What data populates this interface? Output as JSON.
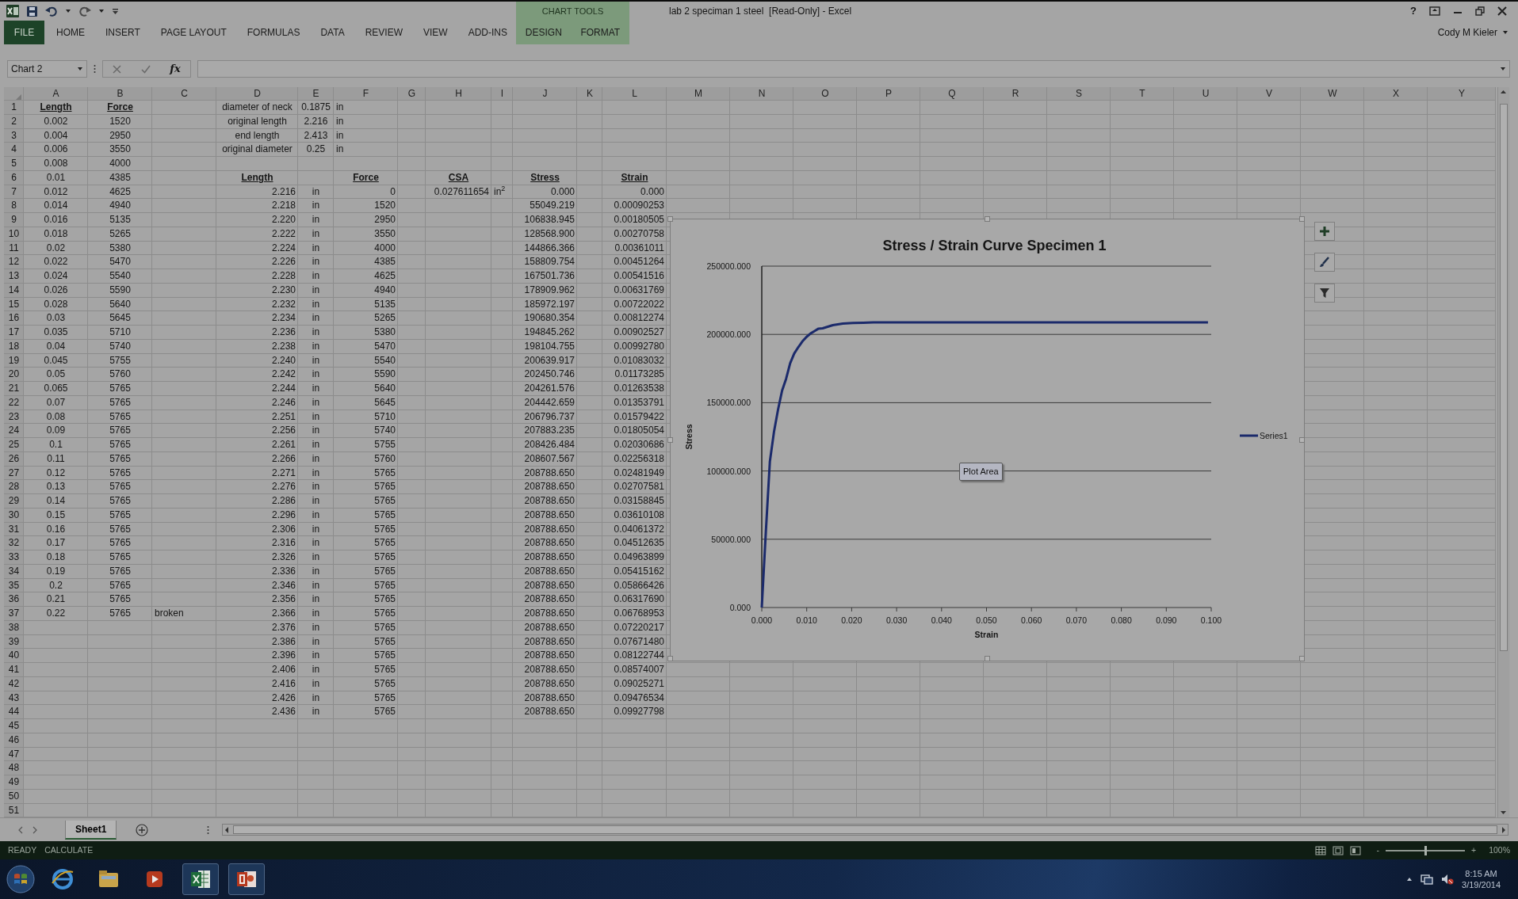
{
  "title_bar": {
    "title": "lab 2 speciman 1 steel  [Read-Only] - Excel",
    "help": "?"
  },
  "ribbon": {
    "tabs": [
      {
        "label": "FILE",
        "kind": "file",
        "selected": false
      },
      {
        "label": "HOME",
        "kind": "tab",
        "selected": false
      },
      {
        "label": "INSERT",
        "kind": "tab",
        "selected": false
      },
      {
        "label": "PAGE LAYOUT",
        "kind": "tab",
        "selected": false
      },
      {
        "label": "FORMULAS",
        "kind": "tab",
        "selected": false
      },
      {
        "label": "DATA",
        "kind": "tab",
        "selected": false
      },
      {
        "label": "REVIEW",
        "kind": "tab",
        "selected": false
      },
      {
        "label": "VIEW",
        "kind": "tab",
        "selected": false
      },
      {
        "label": "ADD-INS",
        "kind": "tab",
        "selected": false
      }
    ],
    "context": {
      "label": "CHART TOOLS",
      "tabs": [
        {
          "label": "DESIGN",
          "selected": false
        },
        {
          "label": "FORMAT",
          "selected": false
        }
      ]
    },
    "user": "Cody M Kieler"
  },
  "formula_bar": {
    "name_box": "Chart 2",
    "function_label": "fx"
  },
  "sheet": {
    "columns": [
      "A",
      "B",
      "C",
      "D",
      "E",
      "F",
      "G",
      "H",
      "I",
      "J",
      "K",
      "L",
      "M",
      "N",
      "O",
      "P",
      "Q",
      "R",
      "S",
      "T",
      "U",
      "V",
      "W",
      "X",
      "Y"
    ],
    "rows": [
      {
        "number": "1",
        "cells": {
          "A": {
            "text": "Length",
            "kind": "heading"
          },
          "B": {
            "text": "Force",
            "kind": "heading"
          },
          "D": {
            "text": "diameter of neck",
            "kind": "center"
          },
          "E": {
            "text": "0.1875",
            "kind": "center"
          },
          "F": {
            "text": "in",
            "kind": "label"
          }
        }
      },
      {
        "number": "2",
        "cells": {
          "A": {
            "text": "0.002",
            "kind": "center"
          },
          "B": {
            "text": "1520",
            "kind": "center"
          },
          "D": {
            "text": "original length",
            "kind": "center"
          },
          "E": {
            "text": "2.216",
            "kind": "center"
          },
          "F": {
            "text": "in",
            "kind": "label"
          }
        }
      },
      {
        "number": "3",
        "cells": {
          "A": {
            "text": "0.004",
            "kind": "center"
          },
          "B": {
            "text": "2950",
            "kind": "center"
          },
          "D": {
            "text": "end length",
            "kind": "center"
          },
          "E": {
            "text": "2.413",
            "kind": "center"
          },
          "F": {
            "text": "in",
            "kind": "label"
          }
        }
      },
      {
        "number": "4",
        "cells": {
          "A": {
            "text": "0.006",
            "kind": "center"
          },
          "B": {
            "text": "3550",
            "kind": "center"
          },
          "D": {
            "text": "original diameter",
            "kind": "center"
          },
          "E": {
            "text": "0.25",
            "kind": "center"
          },
          "F": {
            "text": "in",
            "kind": "label"
          }
        }
      },
      {
        "number": "5",
        "cells": {
          "A": {
            "text": "0.008",
            "kind": "center"
          },
          "B": {
            "text": "4000",
            "kind": "center"
          }
        }
      },
      {
        "number": "6",
        "cells": {
          "A": {
            "text": "0.01",
            "kind": "center"
          },
          "B": {
            "text": "4385",
            "kind": "center"
          },
          "D": {
            "text": "Length",
            "kind": "heading"
          },
          "F": {
            "text": "Force",
            "kind": "heading"
          },
          "H": {
            "text": "CSA",
            "kind": "heading"
          },
          "J": {
            "text": "Stress",
            "kind": "heading"
          },
          "L": {
            "text": "Strain",
            "kind": "heading"
          }
        }
      },
      {
        "number": "7",
        "cells": {
          "A": {
            "text": "0.012",
            "kind": "center"
          },
          "B": {
            "text": "4625",
            "kind": "center"
          },
          "D": {
            "text": "2.216",
            "kind": "number"
          },
          "E": {
            "text": "in",
            "kind": "center"
          },
          "F": {
            "text": "0",
            "kind": "number"
          },
          "H": {
            "text": "0.027611654",
            "kind": "number"
          },
          "I": {
            "text": "in$^{2}$",
            "kind": "label"
          },
          "J": {
            "text": "0.000",
            "kind": "number"
          },
          "L": {
            "text": "0.000",
            "kind": "number"
          }
        }
      },
      {
        "number": "8",
        "cells": {
          "A": {
            "text": "0.014",
            "kind": "center"
          },
          "B": {
            "text": "4940",
            "kind": "center"
          },
          "D": {
            "text": "2.218",
            "kind": "number"
          },
          "E": {
            "text": "in",
            "kind": "center"
          },
          "F": {
            "text": "1520",
            "kind": "number"
          },
          "J": {
            "text": "55049.219",
            "kind": "number"
          },
          "L": {
            "text": "0.00090253",
            "kind": "number"
          }
        }
      },
      {
        "number": "9",
        "cells": {
          "A": {
            "text": "0.016",
            "kind": "center"
          },
          "B": {
            "text": "5135",
            "kind": "center"
          },
          "D": {
            "text": "2.220",
            "kind": "number"
          },
          "E": {
            "text": "in",
            "kind": "center"
          },
          "F": {
            "text": "2950",
            "kind": "number"
          },
          "J": {
            "text": "106838.945",
            "kind": "number"
          },
          "L": {
            "text": "0.00180505",
            "kind": "number"
          }
        }
      },
      {
        "number": "10",
        "cells": {
          "A": {
            "text": "0.018",
            "kind": "center"
          },
          "B": {
            "text": "5265",
            "kind": "center"
          },
          "D": {
            "text": "2.222",
            "kind": "number"
          },
          "E": {
            "text": "in",
            "kind": "center"
          },
          "F": {
            "text": "3550",
            "kind": "number"
          },
          "J": {
            "text": "128568.900",
            "kind": "number"
          },
          "L": {
            "text": "0.00270758",
            "kind": "number"
          }
        }
      },
      {
        "number": "11",
        "cells": {
          "A": {
            "text": "0.02",
            "kind": "center"
          },
          "B": {
            "text": "5380",
            "kind": "center"
          },
          "D": {
            "text": "2.224",
            "kind": "number"
          },
          "E": {
            "text": "in",
            "kind": "center"
          },
          "F": {
            "text": "4000",
            "kind": "number"
          },
          "J": {
            "text": "144866.366",
            "kind": "number"
          },
          "L": {
            "text": "0.00361011",
            "kind": "number"
          }
        }
      },
      {
        "number": "12",
        "cells": {
          "A": {
            "text": "0.022",
            "kind": "center"
          },
          "B": {
            "text": "5470",
            "kind": "center"
          },
          "D": {
            "text": "2.226",
            "kind": "number"
          },
          "E": {
            "text": "in",
            "kind": "center"
          },
          "F": {
            "text": "4385",
            "kind": "number"
          },
          "J": {
            "text": "158809.754",
            "kind": "number"
          },
          "L": {
            "text": "0.00451264",
            "kind": "number"
          }
        }
      },
      {
        "number": "13",
        "cells": {
          "A": {
            "text": "0.024",
            "kind": "center"
          },
          "B": {
            "text": "5540",
            "kind": "center"
          },
          "D": {
            "text": "2.228",
            "kind": "number"
          },
          "E": {
            "text": "in",
            "kind": "center"
          },
          "F": {
            "text": "4625",
            "kind": "number"
          },
          "J": {
            "text": "167501.736",
            "kind": "number"
          },
          "L": {
            "text": "0.00541516",
            "kind": "number"
          }
        }
      },
      {
        "number": "14",
        "cells": {
          "A": {
            "text": "0.026",
            "kind": "center"
          },
          "B": {
            "text": "5590",
            "kind": "center"
          },
          "D": {
            "text": "2.230",
            "kind": "number"
          },
          "E": {
            "text": "in",
            "kind": "center"
          },
          "F": {
            "text": "4940",
            "kind": "number"
          },
          "J": {
            "text": "178909.962",
            "kind": "number"
          },
          "L": {
            "text": "0.00631769",
            "kind": "number"
          }
        }
      },
      {
        "number": "15",
        "cells": {
          "A": {
            "text": "0.028",
            "kind": "center"
          },
          "B": {
            "text": "5640",
            "kind": "center"
          },
          "D": {
            "text": "2.232",
            "kind": "number"
          },
          "E": {
            "text": "in",
            "kind": "center"
          },
          "F": {
            "text": "5135",
            "kind": "number"
          },
          "J": {
            "text": "185972.197",
            "kind": "number"
          },
          "L": {
            "text": "0.00722022",
            "kind": "number"
          }
        }
      },
      {
        "number": "16",
        "cells": {
          "A": {
            "text": "0.03",
            "kind": "center"
          },
          "B": {
            "text": "5645",
            "kind": "center"
          },
          "D": {
            "text": "2.234",
            "kind": "number"
          },
          "E": {
            "text": "in",
            "kind": "center"
          },
          "F": {
            "text": "5265",
            "kind": "number"
          },
          "J": {
            "text": "190680.354",
            "kind": "number"
          },
          "L": {
            "text": "0.00812274",
            "kind": "number"
          }
        }
      },
      {
        "number": "17",
        "cells": {
          "A": {
            "text": "0.035",
            "kind": "center"
          },
          "B": {
            "text": "5710",
            "kind": "center"
          },
          "D": {
            "text": "2.236",
            "kind": "number"
          },
          "E": {
            "text": "in",
            "kind": "center"
          },
          "F": {
            "text": "5380",
            "kind": "number"
          },
          "J": {
            "text": "194845.262",
            "kind": "number"
          },
          "L": {
            "text": "0.00902527",
            "kind": "number"
          }
        }
      },
      {
        "number": "18",
        "cells": {
          "A": {
            "text": "0.04",
            "kind": "center"
          },
          "B": {
            "text": "5740",
            "kind": "center"
          },
          "D": {
            "text": "2.238",
            "kind": "number"
          },
          "E": {
            "text": "in",
            "kind": "center"
          },
          "F": {
            "text": "5470",
            "kind": "number"
          },
          "J": {
            "text": "198104.755",
            "kind": "number"
          },
          "L": {
            "text": "0.00992780",
            "kind": "number"
          }
        }
      },
      {
        "number": "19",
        "cells": {
          "A": {
            "text": "0.045",
            "kind": "center"
          },
          "B": {
            "text": "5755",
            "kind": "center"
          },
          "D": {
            "text": "2.240",
            "kind": "number"
          },
          "E": {
            "text": "in",
            "kind": "center"
          },
          "F": {
            "text": "5540",
            "kind": "number"
          },
          "J": {
            "text": "200639.917",
            "kind": "number"
          },
          "L": {
            "text": "0.01083032",
            "kind": "number"
          }
        }
      },
      {
        "number": "20",
        "cells": {
          "A": {
            "text": "0.05",
            "kind": "center"
          },
          "B": {
            "text": "5760",
            "kind": "center"
          },
          "D": {
            "text": "2.242",
            "kind": "number"
          },
          "E": {
            "text": "in",
            "kind": "center"
          },
          "F": {
            "text": "5590",
            "kind": "number"
          },
          "J": {
            "text": "202450.746",
            "kind": "number"
          },
          "L": {
            "text": "0.01173285",
            "kind": "number"
          }
        }
      },
      {
        "number": "21",
        "cells": {
          "A": {
            "text": "0.065",
            "kind": "center"
          },
          "B": {
            "text": "5765",
            "kind": "center"
          },
          "D": {
            "text": "2.244",
            "kind": "number"
          },
          "E": {
            "text": "in",
            "kind": "center"
          },
          "F": {
            "text": "5640",
            "kind": "number"
          },
          "J": {
            "text": "204261.576",
            "kind": "number"
          },
          "L": {
            "text": "0.01263538",
            "kind": "number"
          }
        }
      },
      {
        "number": "22",
        "cells": {
          "A": {
            "text": "0.07",
            "kind": "center"
          },
          "B": {
            "text": "5765",
            "kind": "center"
          },
          "D": {
            "text": "2.246",
            "kind": "number"
          },
          "E": {
            "text": "in",
            "kind": "center"
          },
          "F": {
            "text": "5645",
            "kind": "number"
          },
          "J": {
            "text": "204442.659",
            "kind": "number"
          },
          "L": {
            "text": "0.01353791",
            "kind": "number"
          }
        }
      },
      {
        "number": "23",
        "cells": {
          "A": {
            "text": "0.08",
            "kind": "center"
          },
          "B": {
            "text": "5765",
            "kind": "center"
          },
          "D": {
            "text": "2.251",
            "kind": "number"
          },
          "E": {
            "text": "in",
            "kind": "center"
          },
          "F": {
            "text": "5710",
            "kind": "number"
          },
          "J": {
            "text": "206796.737",
            "kind": "number"
          },
          "L": {
            "text": "0.01579422",
            "kind": "number"
          }
        }
      },
      {
        "number": "24",
        "cells": {
          "A": {
            "text": "0.09",
            "kind": "center"
          },
          "B": {
            "text": "5765",
            "kind": "center"
          },
          "D": {
            "text": "2.256",
            "kind": "number"
          },
          "E": {
            "text": "in",
            "kind": "center"
          },
          "F": {
            "text": "5740",
            "kind": "number"
          },
          "J": {
            "text": "207883.235",
            "kind": "number"
          },
          "L": {
            "text": "0.01805054",
            "kind": "number"
          }
        }
      },
      {
        "number": "25",
        "cells": {
          "A": {
            "text": "0.1",
            "kind": "center"
          },
          "B": {
            "text": "5765",
            "kind": "center"
          },
          "D": {
            "text": "2.261",
            "kind": "number"
          },
          "E": {
            "text": "in",
            "kind": "center"
          },
          "F": {
            "text": "5755",
            "kind": "number"
          },
          "J": {
            "text": "208426.484",
            "kind": "number"
          },
          "L": {
            "text": "0.02030686",
            "kind": "number"
          }
        }
      },
      {
        "number": "26",
        "cells": {
          "A": {
            "text": "0.11",
            "kind": "center"
          },
          "B": {
            "text": "5765",
            "kind": "center"
          },
          "D": {
            "text": "2.266",
            "kind": "number"
          },
          "E": {
            "text": "in",
            "kind": "center"
          },
          "F": {
            "text": "5760",
            "kind": "number"
          },
          "J": {
            "text": "208607.567",
            "kind": "number"
          },
          "L": {
            "text": "0.02256318",
            "kind": "number"
          }
        }
      },
      {
        "number": "27",
        "cells": {
          "A": {
            "text": "0.12",
            "kind": "center"
          },
          "B": {
            "text": "5765",
            "kind": "center"
          },
          "D": {
            "text": "2.271",
            "kind": "number"
          },
          "E": {
            "text": "in",
            "kind": "center"
          },
          "F": {
            "text": "5765",
            "kind": "number"
          },
          "J": {
            "text": "208788.650",
            "kind": "number"
          },
          "L": {
            "text": "0.02481949",
            "kind": "number"
          }
        }
      },
      {
        "number": "28",
        "cells": {
          "A": {
            "text": "0.13",
            "kind": "center"
          },
          "B": {
            "text": "5765",
            "kind": "center"
          },
          "D": {
            "text": "2.276",
            "kind": "number"
          },
          "E": {
            "text": "in",
            "kind": "center"
          },
          "F": {
            "text": "5765",
            "kind": "number"
          },
          "J": {
            "text": "208788.650",
            "kind": "number"
          },
          "L": {
            "text": "0.02707581",
            "kind": "number"
          }
        }
      },
      {
        "number": "29",
        "cells": {
          "A": {
            "text": "0.14",
            "kind": "center"
          },
          "B": {
            "text": "5765",
            "kind": "center"
          },
          "D": {
            "text": "2.286",
            "kind": "number"
          },
          "E": {
            "text": "in",
            "kind": "center"
          },
          "F": {
            "text": "5765",
            "kind": "number"
          },
          "J": {
            "text": "208788.650",
            "kind": "number"
          },
          "L": {
            "text": "0.03158845",
            "kind": "number"
          }
        }
      },
      {
        "number": "30",
        "cells": {
          "A": {
            "text": "0.15",
            "kind": "center"
          },
          "B": {
            "text": "5765",
            "kind": "center"
          },
          "D": {
            "text": "2.296",
            "kind": "number"
          },
          "E": {
            "text": "in",
            "kind": "center"
          },
          "F": {
            "text": "5765",
            "kind": "number"
          },
          "J": {
            "text": "208788.650",
            "kind": "number"
          },
          "L": {
            "text": "0.03610108",
            "kind": "number"
          }
        }
      },
      {
        "number": "31",
        "cells": {
          "A": {
            "text": "0.16",
            "kind": "center"
          },
          "B": {
            "text": "5765",
            "kind": "center"
          },
          "D": {
            "text": "2.306",
            "kind": "number"
          },
          "E": {
            "text": "in",
            "kind": "center"
          },
          "F": {
            "text": "5765",
            "kind": "number"
          },
          "J": {
            "text": "208788.650",
            "kind": "number"
          },
          "L": {
            "text": "0.04061372",
            "kind": "number"
          }
        }
      },
      {
        "number": "32",
        "cells": {
          "A": {
            "text": "0.17",
            "kind": "center"
          },
          "B": {
            "text": "5765",
            "kind": "center"
          },
          "D": {
            "text": "2.316",
            "kind": "number"
          },
          "E": {
            "text": "in",
            "kind": "center"
          },
          "F": {
            "text": "5765",
            "kind": "number"
          },
          "J": {
            "text": "208788.650",
            "kind": "number"
          },
          "L": {
            "text": "0.04512635",
            "kind": "number"
          }
        }
      },
      {
        "number": "33",
        "cells": {
          "A": {
            "text": "0.18",
            "kind": "center"
          },
          "B": {
            "text": "5765",
            "kind": "center"
          },
          "D": {
            "text": "2.326",
            "kind": "number"
          },
          "E": {
            "text": "in",
            "kind": "center"
          },
          "F": {
            "text": "5765",
            "kind": "number"
          },
          "J": {
            "text": "208788.650",
            "kind": "number"
          },
          "L": {
            "text": "0.04963899",
            "kind": "number"
          }
        }
      },
      {
        "number": "34",
        "cells": {
          "A": {
            "text": "0.19",
            "kind": "center"
          },
          "B": {
            "text": "5765",
            "kind": "center"
          },
          "D": {
            "text": "2.336",
            "kind": "number"
          },
          "E": {
            "text": "in",
            "kind": "center"
          },
          "F": {
            "text": "5765",
            "kind": "number"
          },
          "J": {
            "text": "208788.650",
            "kind": "number"
          },
          "L": {
            "text": "0.05415162",
            "kind": "number"
          }
        }
      },
      {
        "number": "35",
        "cells": {
          "A": {
            "text": "0.2",
            "kind": "center"
          },
          "B": {
            "text": "5765",
            "kind": "center"
          },
          "D": {
            "text": "2.346",
            "kind": "number"
          },
          "E": {
            "text": "in",
            "kind": "center"
          },
          "F": {
            "text": "5765",
            "kind": "number"
          },
          "J": {
            "text": "208788.650",
            "kind": "number"
          },
          "L": {
            "text": "0.05866426",
            "kind": "number"
          }
        }
      },
      {
        "number": "36",
        "cells": {
          "A": {
            "text": "0.21",
            "kind": "center"
          },
          "B": {
            "text": "5765",
            "kind": "center"
          },
          "D": {
            "text": "2.356",
            "kind": "number"
          },
          "E": {
            "text": "in",
            "kind": "center"
          },
          "F": {
            "text": "5765",
            "kind": "number"
          },
          "J": {
            "text": "208788.650",
            "kind": "number"
          },
          "L": {
            "text": "0.06317690",
            "kind": "number"
          }
        }
      },
      {
        "number": "37",
        "cells": {
          "A": {
            "text": "0.22",
            "kind": "center"
          },
          "B": {
            "text": "5765",
            "kind": "center"
          },
          "C": {
            "text": "broken",
            "kind": "label"
          },
          "D": {
            "text": "2.366",
            "kind": "number"
          },
          "E": {
            "text": "in",
            "kind": "center"
          },
          "F": {
            "text": "5765",
            "kind": "number"
          },
          "J": {
            "text": "208788.650",
            "kind": "number"
          },
          "L": {
            "text": "0.06768953",
            "kind": "number"
          }
        }
      },
      {
        "number": "38",
        "cells": {
          "D": {
            "text": "2.376",
            "kind": "number"
          },
          "E": {
            "text": "in",
            "kind": "center"
          },
          "F": {
            "text": "5765",
            "kind": "number"
          },
          "J": {
            "text": "208788.650",
            "kind": "number"
          },
          "L": {
            "text": "0.07220217",
            "kind": "number"
          }
        }
      },
      {
        "number": "39",
        "cells": {
          "D": {
            "text": "2.386",
            "kind": "number"
          },
          "E": {
            "text": "in",
            "kind": "center"
          },
          "F": {
            "text": "5765",
            "kind": "number"
          },
          "J": {
            "text": "208788.650",
            "kind": "number"
          },
          "L": {
            "text": "0.07671480",
            "kind": "number"
          }
        }
      },
      {
        "number": "40",
        "cells": {
          "D": {
            "text": "2.396",
            "kind": "number"
          },
          "E": {
            "text": "in",
            "kind": "center"
          },
          "F": {
            "text": "5765",
            "kind": "number"
          },
          "J": {
            "text": "208788.650",
            "kind": "number"
          },
          "L": {
            "text": "0.08122744",
            "kind": "number"
          }
        }
      },
      {
        "number": "41",
        "cells": {
          "D": {
            "text": "2.406",
            "kind": "number"
          },
          "E": {
            "text": "in",
            "kind": "center"
          },
          "F": {
            "text": "5765",
            "kind": "number"
          },
          "J": {
            "text": "208788.650",
            "kind": "number"
          },
          "L": {
            "text": "0.08574007",
            "kind": "number"
          }
        }
      },
      {
        "number": "42",
        "cells": {
          "D": {
            "text": "2.416",
            "kind": "number"
          },
          "E": {
            "text": "in",
            "kind": "center"
          },
          "F": {
            "text": "5765",
            "kind": "number"
          },
          "J": {
            "text": "208788.650",
            "kind": "number"
          },
          "L": {
            "text": "0.09025271",
            "kind": "number"
          }
        }
      },
      {
        "number": "43",
        "cells": {
          "D": {
            "text": "2.426",
            "kind": "number"
          },
          "E": {
            "text": "in",
            "kind": "center"
          },
          "F": {
            "text": "5765",
            "kind": "number"
          },
          "J": {
            "text": "208788.650",
            "kind": "number"
          },
          "L": {
            "text": "0.09476534",
            "kind": "number"
          }
        }
      },
      {
        "number": "44",
        "cells": {
          "D": {
            "text": "2.436",
            "kind": "number"
          },
          "E": {
            "text": "in",
            "kind": "center"
          },
          "F": {
            "text": "5765",
            "kind": "number"
          },
          "J": {
            "text": "208788.650",
            "kind": "number"
          },
          "L": {
            "text": "0.09927798",
            "kind": "number"
          }
        }
      },
      {
        "number": "45"
      },
      {
        "number": "46"
      },
      {
        "number": "47"
      },
      {
        "number": "48"
      },
      {
        "number": "49"
      },
      {
        "number": "50"
      },
      {
        "number": "51"
      }
    ]
  },
  "chart": {
    "tooltip": "Plot Area",
    "chart_data": {
      "type": "line",
      "title": "Stress / Strain Curve Specimen 1",
      "xlabel": "Strain",
      "ylabel": "Stress",
      "x": [
        0,
        0.00090253,
        0.00180505,
        0.00270758,
        0.00361011,
        0.00451264,
        0.00541516,
        0.00631769,
        0.00722022,
        0.00812274,
        0.00902527,
        0.0099278,
        0.01083032,
        0.01173285,
        0.01263538,
        0.01353791,
        0.01579422,
        0.01805054,
        0.02030686,
        0.02256318,
        0.02481949,
        0.02707581,
        0.03158845,
        0.03610108,
        0.04061372,
        0.04512635,
        0.04963899,
        0.05415162,
        0.05866426,
        0.0631769,
        0.06768953,
        0.07220217,
        0.0767148,
        0.08122744,
        0.08574007,
        0.09025271,
        0.09476534,
        0.09927798
      ],
      "series": [
        {
          "name": "Series1",
          "color": "#1b2a6b",
          "values": [
            0,
            55049.219,
            106838.945,
            128568.9,
            144866.366,
            158809.754,
            167501.736,
            178909.962,
            185972.197,
            190680.354,
            194845.262,
            198104.755,
            200639.917,
            202450.746,
            204261.576,
            204442.659,
            206796.737,
            207883.235,
            208426.484,
            208607.567,
            208788.65,
            208788.65,
            208788.65,
            208788.65,
            208788.65,
            208788.65,
            208788.65,
            208788.65,
            208788.65,
            208788.65,
            208788.65,
            208788.65,
            208788.65,
            208788.65,
            208788.65,
            208788.65,
            208788.65,
            208788.65
          ]
        }
      ],
      "xlim": [
        0,
        0.1
      ],
      "ylim": [
        0,
        250000
      ],
      "grid": true,
      "xticks": [
        {
          "value": 0,
          "label": "0.000"
        },
        {
          "value": 0.01,
          "label": "0.010"
        },
        {
          "value": 0.02,
          "label": "0.020"
        },
        {
          "value": 0.03,
          "label": "0.030"
        },
        {
          "value": 0.04,
          "label": "0.040"
        },
        {
          "value": 0.05,
          "label": "0.050"
        },
        {
          "value": 0.06,
          "label": "0.060"
        },
        {
          "value": 0.07,
          "label": "0.070"
        },
        {
          "value": 0.08,
          "label": "0.080"
        },
        {
          "value": 0.09,
          "label": "0.090"
        },
        {
          "value": 0.1,
          "label": "0.100"
        }
      ],
      "yticks": [
        {
          "value": 0,
          "label": "0.000"
        },
        {
          "value": 50000,
          "label": "50000.000"
        },
        {
          "value": 100000,
          "label": "100000.000"
        },
        {
          "value": 150000,
          "label": "150000.000"
        },
        {
          "value": 200000,
          "label": "200000.000"
        },
        {
          "value": 250000,
          "label": "250000.000"
        }
      ]
    }
  },
  "sheet_tabs": [
    {
      "label": "Sheet1",
      "selected": true
    }
  ],
  "status_bar": {
    "items": [
      "READY",
      "CALCULATE"
    ],
    "zoom": {
      "minus": "-",
      "plus": "+",
      "level": 0.5,
      "reading": "100%"
    }
  },
  "taskbar": {
    "time": "8:15 AM",
    "date": "3/19/2014"
  }
}
